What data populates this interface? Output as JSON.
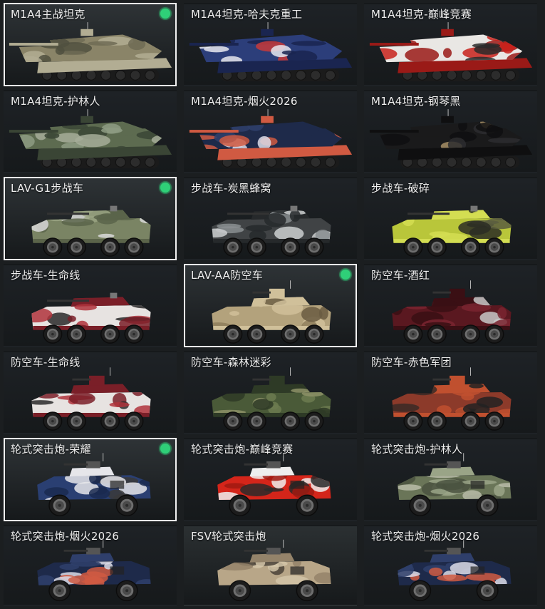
{
  "cards": [
    {
      "label": "M1A4主战坦克",
      "vehicle": "tank",
      "skin": "woodland-desert",
      "selected": true,
      "equipped": true,
      "bg": "#2e3336",
      "colors": [
        "#8a8468",
        "#6f6b55",
        "#b2ad93",
        "#50503f"
      ]
    },
    {
      "label": "M1A4坦克-哈夫克重工",
      "vehicle": "tank",
      "skin": "haavk-blue",
      "selected": false,
      "equipped": false,
      "bg": "#1e2226",
      "colors": [
        "#2c3e7a",
        "#e8e8ef",
        "#1a2550",
        "#c83a3a"
      ]
    },
    {
      "label": "M1A4坦克-巅峰竞赛",
      "vehicle": "tank",
      "skin": "racing-red",
      "selected": false,
      "equipped": false,
      "bg": "#1e2226",
      "colors": [
        "#e9e7e4",
        "#c8221c",
        "#9a1a17",
        "#2a2a2a"
      ]
    },
    {
      "label": "M1A4坦克-护林人",
      "vehicle": "tank",
      "skin": "forest-camo",
      "selected": false,
      "equipped": false,
      "bg": "#1e2226",
      "colors": [
        "#5d6b50",
        "#8d9b82",
        "#3a4535",
        "#a6ad99"
      ]
    },
    {
      "label": "M1A4坦克-烟火2026",
      "vehicle": "tank",
      "skin": "fireworks-2026",
      "selected": false,
      "equipped": false,
      "bg": "#1e2226",
      "colors": [
        "#1e2a4a",
        "#2f3f6b",
        "#d05a42",
        "#dcdce8"
      ]
    },
    {
      "label": "M1A4坦克-钢琴黑",
      "vehicle": "tank",
      "skin": "piano-black",
      "selected": false,
      "equipped": false,
      "bg": "#1e2226",
      "colors": [
        "#1a1a1b",
        "#2d2d2f",
        "#0f0f10",
        "#a89066"
      ]
    },
    {
      "label": "LAV-G1步战车",
      "vehicle": "ifv",
      "skin": "olive",
      "selected": true,
      "equipped": true,
      "bg": "#2e3336",
      "colors": [
        "#7a8464",
        "#9aa383",
        "#5b644a",
        "#d9d9d9"
      ]
    },
    {
      "label": "步战车-炭黑蜂窝",
      "vehicle": "ifv",
      "skin": "charcoal-honeycomb",
      "selected": false,
      "equipped": false,
      "bg": "#1e2226",
      "colors": [
        "#404345",
        "#8a8e90",
        "#26292b",
        "#cdcfd0"
      ]
    },
    {
      "label": "步战车-破碎",
      "vehicle": "ifv",
      "skin": "shattered-lime",
      "selected": false,
      "equipped": false,
      "bg": "#1e2226",
      "colors": [
        "#b9c63a",
        "#2b2d25",
        "#d3dd52",
        "#5a5d40"
      ]
    },
    {
      "label": "步战车-生命线",
      "vehicle": "ifv",
      "skin": "lifeline",
      "selected": false,
      "equipped": false,
      "bg": "#1e2226",
      "colors": [
        "#e7e3e1",
        "#b0343c",
        "#7a1f28",
        "#2a2a2a"
      ]
    },
    {
      "label": "LAV-AA防空车",
      "vehicle": "aa",
      "skin": "desert",
      "selected": true,
      "equipped": true,
      "bg": "#2e3336",
      "colors": [
        "#b3a27c",
        "#8e7e5c",
        "#d0c09a",
        "#6a5c42"
      ]
    },
    {
      "label": "防空车-酒红",
      "vehicle": "aa",
      "skin": "wine-red",
      "selected": false,
      "equipped": false,
      "bg": "#1e2226",
      "colors": [
        "#5a1820",
        "#7a2530",
        "#3a0f14",
        "#c8c8c8"
      ]
    },
    {
      "label": "防空车-生命线",
      "vehicle": "aa",
      "skin": "lifeline",
      "selected": false,
      "equipped": false,
      "bg": "#1e2226",
      "colors": [
        "#e7e3e1",
        "#b0343c",
        "#7a1f28",
        "#2a2a2a"
      ]
    },
    {
      "label": "防空车-森林迷彩",
      "vehicle": "aa",
      "skin": "forest-camo",
      "selected": false,
      "equipped": false,
      "bg": "#1e2226",
      "colors": [
        "#4a5a38",
        "#6c7b50",
        "#2e3a26",
        "#8d9267"
      ]
    },
    {
      "label": "防空车-赤色军团",
      "vehicle": "aa",
      "skin": "red-legion",
      "selected": false,
      "equipped": false,
      "bg": "#1e2226",
      "colors": [
        "#8c3a2a",
        "#3a2a26",
        "#c0502f",
        "#222222"
      ]
    },
    {
      "label": "轮式突击炮-荣耀",
      "vehicle": "buggy",
      "skin": "glory",
      "selected": true,
      "equipped": true,
      "bg": "#2e3336",
      "colors": [
        "#2a3f72",
        "#e6e6ea",
        "#1a2a50",
        "#3a3a3a"
      ]
    },
    {
      "label": "轮式突击炮-巅峰竞赛",
      "vehicle": "buggy",
      "skin": "racing-red",
      "selected": false,
      "equipped": false,
      "bg": "#1e2226",
      "colors": [
        "#d4251a",
        "#eeeeee",
        "#a01a12",
        "#2a2a2a"
      ]
    },
    {
      "label": "轮式突击炮-护林人",
      "vehicle": "buggy",
      "skin": "forest-camo",
      "selected": false,
      "equipped": false,
      "bg": "#1e2226",
      "colors": [
        "#6a7558",
        "#9aa487",
        "#4a5240",
        "#b8bca8"
      ]
    },
    {
      "label": "轮式突击炮-烟火2026",
      "vehicle": "buggy",
      "skin": "fireworks-2026",
      "selected": false,
      "equipped": false,
      "bg": "#1e2226",
      "colors": [
        "#1e2a4a",
        "#2f3f6b",
        "#d05a42",
        "#dcdce8"
      ]
    },
    {
      "label": "FSV轮式突击炮",
      "vehicle": "buggy",
      "skin": "desert",
      "selected": false,
      "equipped": false,
      "bg": "#2b3032",
      "colors": [
        "#b8a688",
        "#94836a",
        "#d2c4a8",
        "#4a4238"
      ]
    },
    {
      "label": "轮式突击炮-烟火2026",
      "vehicle": "buggy",
      "skin": "fireworks-2026",
      "selected": false,
      "equipped": false,
      "bg": "#1e2226",
      "colors": [
        "#1e2a4a",
        "#2f3f6b",
        "#d05a42",
        "#dcdce8"
      ]
    }
  ]
}
